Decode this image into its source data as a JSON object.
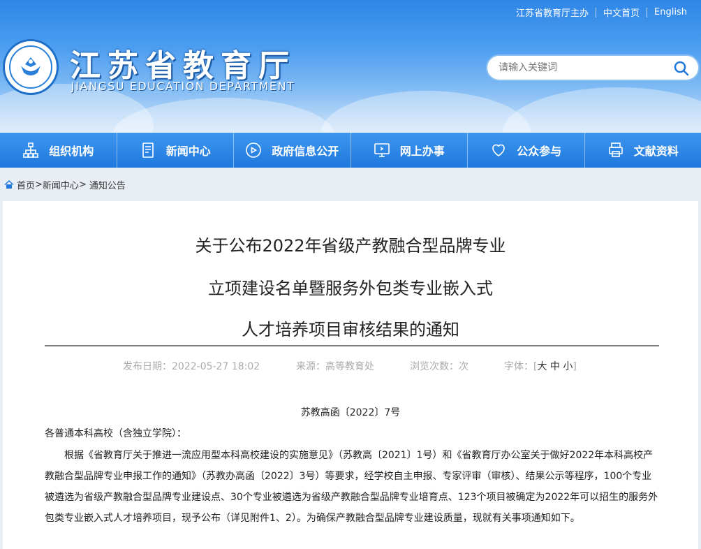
{
  "top_links": {
    "host": "江苏省教育厅主办",
    "home": "中文首页",
    "english": "English"
  },
  "logo": {
    "title": "江苏省教育厅",
    "subtitle": "JIANGSU EDUCATION DEPARTMENT",
    "emblem_icon": "jiangsu-education-emblem-icon"
  },
  "search": {
    "placeholder": "请输入关键词",
    "icon": "search-icon"
  },
  "nav": {
    "items": [
      {
        "label": "组织机构",
        "icon": "org-chart-icon"
      },
      {
        "label": "新闻中心",
        "icon": "news-document-icon"
      },
      {
        "label": "政府信息公开",
        "icon": "play-circle-icon"
      },
      {
        "label": "网上办事",
        "icon": "monitor-icon"
      },
      {
        "label": "公众参与",
        "icon": "heart-icon"
      },
      {
        "label": "文献资料",
        "icon": "printer-icon"
      }
    ]
  },
  "breadcrumb": {
    "icon": "home-icon",
    "home": "首页",
    "sep": ">",
    "news": "新闻中心",
    "notice": "通知公告"
  },
  "article": {
    "title_line1": "关于公布2022年省级产教融合型品牌专业",
    "title_line2": "立项建设名单暨服务外包类专业嵌入式",
    "title_line3": "人才培养项目审核结果的通知",
    "publish_label": "发布日期：",
    "publish_date": "2022-05-27 18:02",
    "source_label": "来源：",
    "source": "高等教育处",
    "views_label": "浏览次数：",
    "views_unit": "次",
    "font_label": "字体：",
    "font_open": "[",
    "font_large": "大",
    "font_medium": "中",
    "font_small": "小",
    "font_close": "]",
    "doc_number": "苏教高函〔2022〕7号",
    "salutation": "各普通本科高校（含独立学院）：",
    "body": "根据《省教育厅关于推进一流应用型本科高校建设的实施意见》（苏教高〔2021〕1号）和《省教育厅办公室关于做好2022年本科高校产教融合型品牌专业申报工作的通知》（苏教办高函〔2022〕3号）等要求，经学校自主申报、专家评审（审核）、结果公示等程序，100个专业被遴选为省级产教融合型品牌专业建设点、30个专业被遴选为省级产教融合型品牌专业培育点、123个项目被确定为2022年可以招生的服务外包类专业嵌入式人才培养项目，现予公布（详见附件1、2）。为确保产教融合型品牌专业建设质量，现就有关事项通知如下。"
  }
}
